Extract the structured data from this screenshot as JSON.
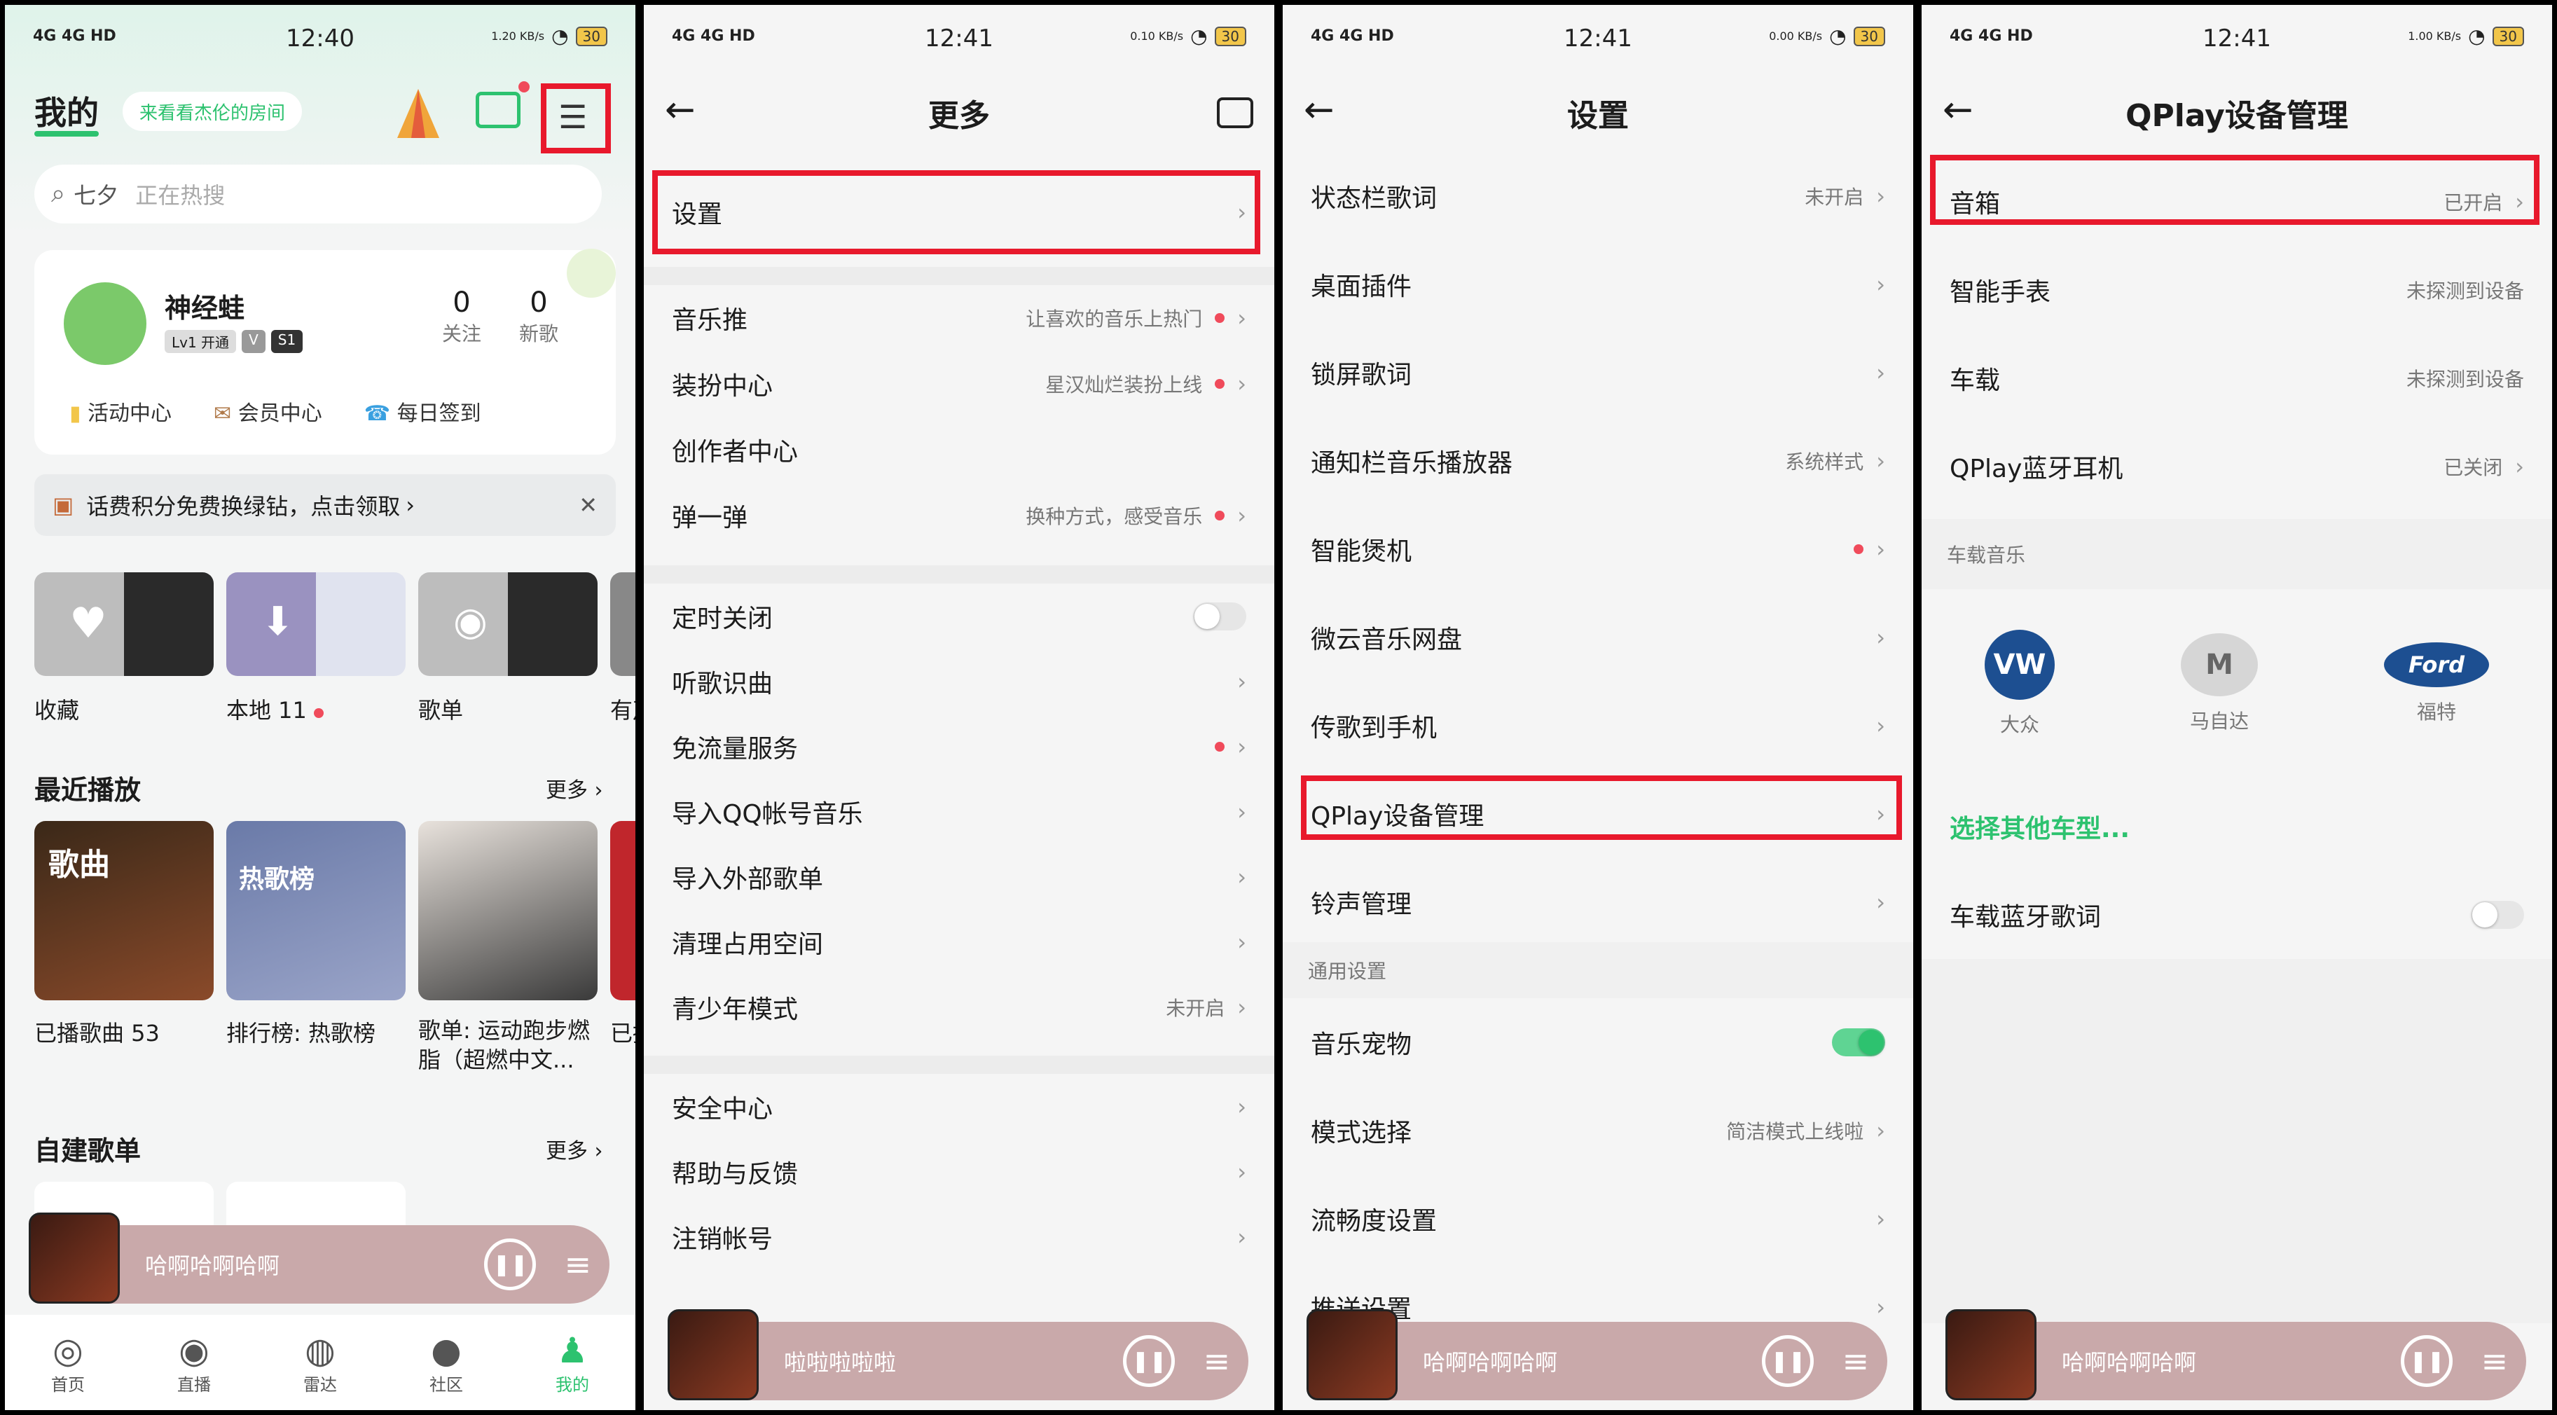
{
  "status": {
    "signal": "4G 4G HD",
    "times": [
      "12:40",
      "12:41",
      "12:41",
      "12:41"
    ],
    "speeds": [
      "1.20 KB/s",
      "0.10 KB/s",
      "0.00 KB/s",
      "1.00 KB/s"
    ],
    "battery": "30"
  },
  "p1": {
    "tab_mine": "我的",
    "room_btn": "来看看杰伦的房间",
    "search_placeholder": "七夕",
    "search_hot": "正在热搜",
    "username": "神经蛙",
    "badge_lv": "Lv1 开通",
    "badge_v": "V",
    "badge_s": "S1",
    "follow_count": "0",
    "follow_label": "关注",
    "new_count": "0",
    "new_label": "新歌",
    "activity": "活动中心",
    "vip": "会员中心",
    "checkin": "每日签到",
    "banner": "话费积分免费换绿钻，点击领取",
    "banner_arrow": "›",
    "banner_close": "✕",
    "shelf": [
      {
        "label": "收藏"
      },
      {
        "label": "本地 11"
      },
      {
        "label": "歌单"
      },
      {
        "label": "有声"
      }
    ],
    "recent_title": "最近播放",
    "more": "更多",
    "recent": [
      {
        "label": "已播歌曲 53",
        "cover_text": "歌曲"
      },
      {
        "label": "排行榜: 热歌榜",
        "cover_text": "热歌榜"
      },
      {
        "label": "歌单: 运动跑步燃脂（超燃中文...",
        "cover_text": ""
      },
      {
        "label": "已播",
        "cover_text": ""
      }
    ],
    "self_title": "自建歌单",
    "player_title": "哈啊哈啊哈啊",
    "nav": [
      {
        "label": "首页"
      },
      {
        "label": "直播"
      },
      {
        "label": "雷达"
      },
      {
        "label": "社区"
      },
      {
        "label": "我的"
      }
    ]
  },
  "p2": {
    "title": "更多",
    "settings": "设置",
    "items1": [
      {
        "label": "音乐推",
        "sub": "让喜欢的音乐上热门",
        "dot": true
      },
      {
        "label": "装扮中心",
        "sub": "星汉灿烂装扮上线",
        "dot": true
      },
      {
        "label": "创作者中心",
        "sub": "",
        "dot": false
      },
      {
        "label": "弹一弹",
        "sub": "换种方式，感受音乐",
        "dot": true
      }
    ],
    "items2": [
      {
        "label": "定时关闭"
      },
      {
        "label": "听歌识曲"
      },
      {
        "label": "免流量服务"
      },
      {
        "label": "导入QQ帐号音乐"
      },
      {
        "label": "导入外部歌单"
      },
      {
        "label": "清理占用空间"
      },
      {
        "label": "青少年模式",
        "sub": "未开启"
      }
    ],
    "items3": [
      {
        "label": "安全中心"
      },
      {
        "label": "帮助与反馈"
      },
      {
        "label": "注销帐号"
      }
    ],
    "player_title": "啦啦啦啦啦"
  },
  "p3": {
    "title": "设置",
    "items": [
      {
        "label": "状态栏歌词",
        "sub": "未开启"
      },
      {
        "label": "桌面插件",
        "sub": ""
      },
      {
        "label": "锁屏歌词",
        "sub": ""
      },
      {
        "label": "通知栏音乐播放器",
        "sub": "系统样式"
      },
      {
        "label": "智能煲机",
        "sub": ""
      },
      {
        "label": "微云音乐网盘",
        "sub": ""
      },
      {
        "label": "传歌到手机",
        "sub": ""
      },
      {
        "label": "QPlay设备管理",
        "sub": ""
      },
      {
        "label": "铃声管理",
        "sub": ""
      }
    ],
    "section": "通用设置",
    "items2": [
      {
        "label": "音乐宠物",
        "sub": ""
      },
      {
        "label": "模式选择",
        "sub": "简洁模式上线啦"
      },
      {
        "label": "流畅度设置",
        "sub": ""
      },
      {
        "label": "推送设置",
        "sub": ""
      }
    ],
    "player_title": "哈啊哈啊哈啊"
  },
  "p4": {
    "title": "QPlay设备管理",
    "items": [
      {
        "label": "音箱",
        "sub": "已开启"
      },
      {
        "label": "智能手表",
        "sub": "未探测到设备"
      },
      {
        "label": "车载",
        "sub": "未探测到设备"
      },
      {
        "label": "QPlay蓝牙耳机",
        "sub": "已关闭"
      }
    ],
    "car_section": "车载音乐",
    "brands": [
      {
        "label": "大众",
        "logo": "VW"
      },
      {
        "label": "马自达",
        "logo": "M"
      },
      {
        "label": "福特",
        "logo": "Ford"
      }
    ],
    "other": "选择其他车型...",
    "bt_lyrics": "车载蓝牙歌词",
    "player_title": "哈啊哈啊哈啊"
  },
  "chevron": "›",
  "colors": {
    "accent": "#2dc26f",
    "highlight": "#e8192c",
    "player": "#c9a9aa"
  }
}
